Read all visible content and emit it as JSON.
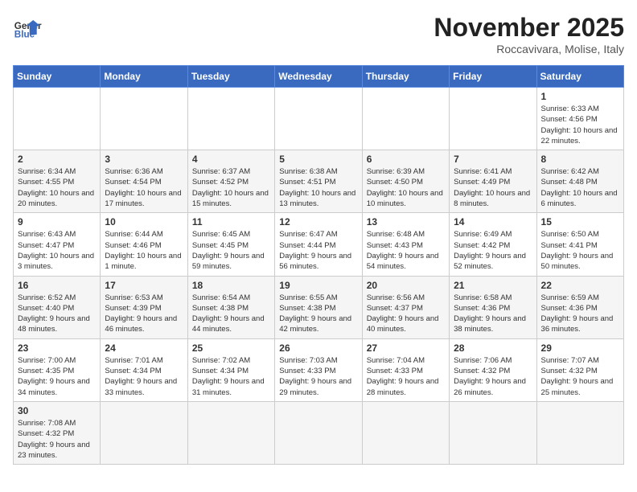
{
  "header": {
    "logo_general": "General",
    "logo_blue": "Blue",
    "title": "November 2025",
    "subtitle": "Roccavivara, Molise, Italy"
  },
  "days_of_week": [
    "Sunday",
    "Monday",
    "Tuesday",
    "Wednesday",
    "Thursday",
    "Friday",
    "Saturday"
  ],
  "weeks": [
    [
      {
        "day": null,
        "info": ""
      },
      {
        "day": null,
        "info": ""
      },
      {
        "day": null,
        "info": ""
      },
      {
        "day": null,
        "info": ""
      },
      {
        "day": null,
        "info": ""
      },
      {
        "day": null,
        "info": ""
      },
      {
        "day": "1",
        "info": "Sunrise: 6:33 AM\nSunset: 4:56 PM\nDaylight: 10 hours and 22 minutes."
      }
    ],
    [
      {
        "day": "2",
        "info": "Sunrise: 6:34 AM\nSunset: 4:55 PM\nDaylight: 10 hours and 20 minutes."
      },
      {
        "day": "3",
        "info": "Sunrise: 6:36 AM\nSunset: 4:54 PM\nDaylight: 10 hours and 17 minutes."
      },
      {
        "day": "4",
        "info": "Sunrise: 6:37 AM\nSunset: 4:52 PM\nDaylight: 10 hours and 15 minutes."
      },
      {
        "day": "5",
        "info": "Sunrise: 6:38 AM\nSunset: 4:51 PM\nDaylight: 10 hours and 13 minutes."
      },
      {
        "day": "6",
        "info": "Sunrise: 6:39 AM\nSunset: 4:50 PM\nDaylight: 10 hours and 10 minutes."
      },
      {
        "day": "7",
        "info": "Sunrise: 6:41 AM\nSunset: 4:49 PM\nDaylight: 10 hours and 8 minutes."
      },
      {
        "day": "8",
        "info": "Sunrise: 6:42 AM\nSunset: 4:48 PM\nDaylight: 10 hours and 6 minutes."
      }
    ],
    [
      {
        "day": "9",
        "info": "Sunrise: 6:43 AM\nSunset: 4:47 PM\nDaylight: 10 hours and 3 minutes."
      },
      {
        "day": "10",
        "info": "Sunrise: 6:44 AM\nSunset: 4:46 PM\nDaylight: 10 hours and 1 minute."
      },
      {
        "day": "11",
        "info": "Sunrise: 6:45 AM\nSunset: 4:45 PM\nDaylight: 9 hours and 59 minutes."
      },
      {
        "day": "12",
        "info": "Sunrise: 6:47 AM\nSunset: 4:44 PM\nDaylight: 9 hours and 56 minutes."
      },
      {
        "day": "13",
        "info": "Sunrise: 6:48 AM\nSunset: 4:43 PM\nDaylight: 9 hours and 54 minutes."
      },
      {
        "day": "14",
        "info": "Sunrise: 6:49 AM\nSunset: 4:42 PM\nDaylight: 9 hours and 52 minutes."
      },
      {
        "day": "15",
        "info": "Sunrise: 6:50 AM\nSunset: 4:41 PM\nDaylight: 9 hours and 50 minutes."
      }
    ],
    [
      {
        "day": "16",
        "info": "Sunrise: 6:52 AM\nSunset: 4:40 PM\nDaylight: 9 hours and 48 minutes."
      },
      {
        "day": "17",
        "info": "Sunrise: 6:53 AM\nSunset: 4:39 PM\nDaylight: 9 hours and 46 minutes."
      },
      {
        "day": "18",
        "info": "Sunrise: 6:54 AM\nSunset: 4:38 PM\nDaylight: 9 hours and 44 minutes."
      },
      {
        "day": "19",
        "info": "Sunrise: 6:55 AM\nSunset: 4:38 PM\nDaylight: 9 hours and 42 minutes."
      },
      {
        "day": "20",
        "info": "Sunrise: 6:56 AM\nSunset: 4:37 PM\nDaylight: 9 hours and 40 minutes."
      },
      {
        "day": "21",
        "info": "Sunrise: 6:58 AM\nSunset: 4:36 PM\nDaylight: 9 hours and 38 minutes."
      },
      {
        "day": "22",
        "info": "Sunrise: 6:59 AM\nSunset: 4:36 PM\nDaylight: 9 hours and 36 minutes."
      }
    ],
    [
      {
        "day": "23",
        "info": "Sunrise: 7:00 AM\nSunset: 4:35 PM\nDaylight: 9 hours and 34 minutes."
      },
      {
        "day": "24",
        "info": "Sunrise: 7:01 AM\nSunset: 4:34 PM\nDaylight: 9 hours and 33 minutes."
      },
      {
        "day": "25",
        "info": "Sunrise: 7:02 AM\nSunset: 4:34 PM\nDaylight: 9 hours and 31 minutes."
      },
      {
        "day": "26",
        "info": "Sunrise: 7:03 AM\nSunset: 4:33 PM\nDaylight: 9 hours and 29 minutes."
      },
      {
        "day": "27",
        "info": "Sunrise: 7:04 AM\nSunset: 4:33 PM\nDaylight: 9 hours and 28 minutes."
      },
      {
        "day": "28",
        "info": "Sunrise: 7:06 AM\nSunset: 4:32 PM\nDaylight: 9 hours and 26 minutes."
      },
      {
        "day": "29",
        "info": "Sunrise: 7:07 AM\nSunset: 4:32 PM\nDaylight: 9 hours and 25 minutes."
      }
    ],
    [
      {
        "day": "30",
        "info": "Sunrise: 7:08 AM\nSunset: 4:32 PM\nDaylight: 9 hours and 23 minutes."
      },
      {
        "day": null,
        "info": ""
      },
      {
        "day": null,
        "info": ""
      },
      {
        "day": null,
        "info": ""
      },
      {
        "day": null,
        "info": ""
      },
      {
        "day": null,
        "info": ""
      },
      {
        "day": null,
        "info": ""
      }
    ]
  ]
}
